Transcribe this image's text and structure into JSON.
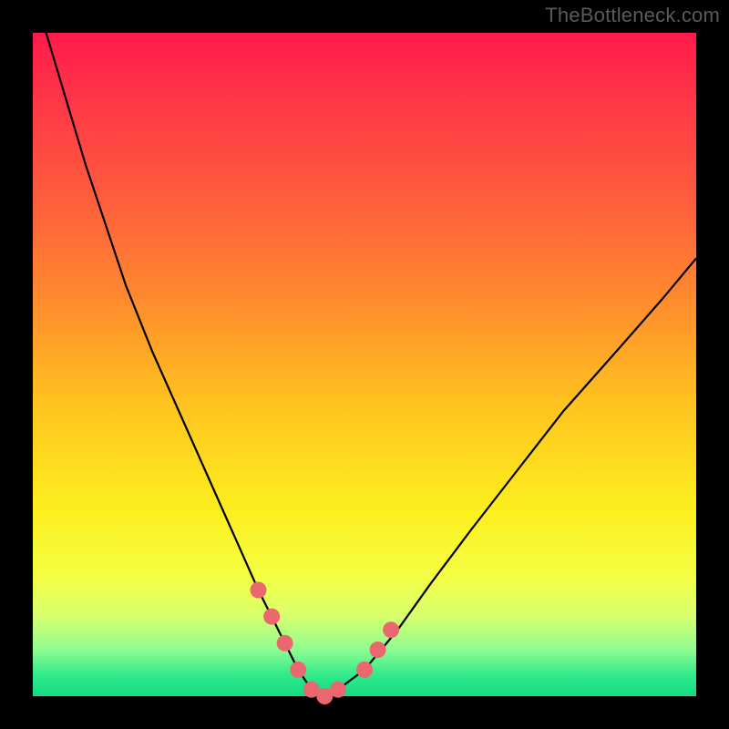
{
  "watermark": "TheBottleneck.com",
  "colors": {
    "frame_bg": "#000000",
    "watermark_text": "#5a5a5a",
    "curve_stroke": "#000000",
    "marker_fill": "#e9676d",
    "gradient_stops": [
      "#ff1a4c",
      "#ff5a3d",
      "#ffc31f",
      "#f4ff44",
      "#17d884"
    ]
  },
  "chart_data": {
    "type": "line",
    "title": "",
    "xlabel": "",
    "ylabel": "",
    "xlim": [
      0,
      100
    ],
    "ylim": [
      0,
      100
    ],
    "x": [
      0,
      2,
      5,
      8,
      11,
      14,
      18,
      22,
      26,
      30,
      34,
      36,
      38,
      40,
      42,
      44,
      46,
      50,
      55,
      60,
      66,
      73,
      80,
      88,
      95,
      100
    ],
    "values": [
      110,
      100,
      90,
      80,
      71,
      62,
      52,
      43,
      34,
      25,
      16,
      12,
      8,
      4,
      1,
      0,
      1,
      4,
      10,
      17,
      25,
      34,
      43,
      52,
      60,
      66
    ],
    "marker_points": [
      {
        "x": 34,
        "y": 16
      },
      {
        "x": 36,
        "y": 12
      },
      {
        "x": 38,
        "y": 8
      },
      {
        "x": 40,
        "y": 4
      },
      {
        "x": 42,
        "y": 1
      },
      {
        "x": 44,
        "y": 0
      },
      {
        "x": 46,
        "y": 1
      },
      {
        "x": 50,
        "y": 4
      },
      {
        "x": 52,
        "y": 7
      },
      {
        "x": 54,
        "y": 10
      }
    ],
    "notes": "Axes are unlabeled; values are proportional estimates read from the plot area. y=0 corresponds to the bottom of the gradient panel. The curve enters from above the top edge on the left (y≈110)."
  }
}
